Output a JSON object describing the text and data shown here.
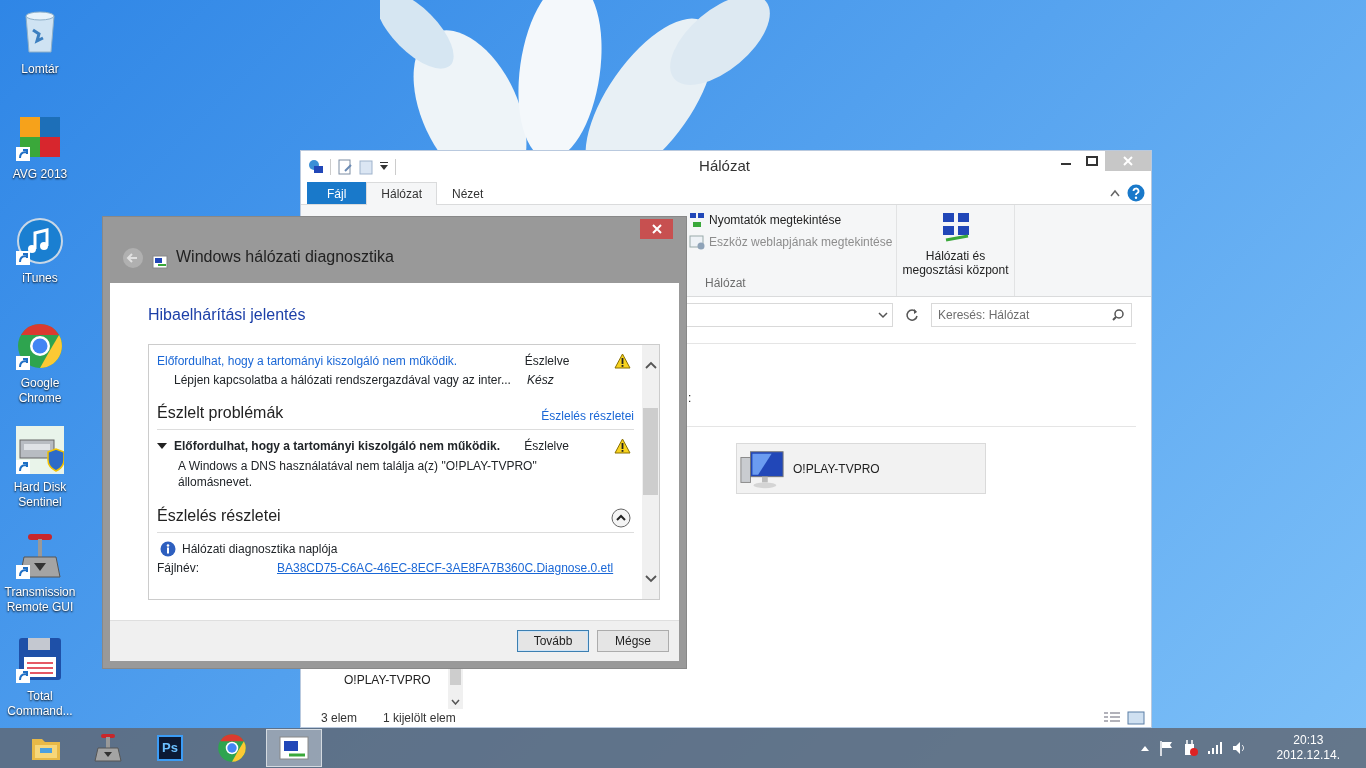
{
  "desktop": {
    "icons": [
      {
        "label": "Lomtár",
        "kind": "bin",
        "shortcut": false
      },
      {
        "label": "AVG 2013",
        "kind": "avg",
        "shortcut": true
      },
      {
        "label": "iTunes",
        "kind": "music",
        "shortcut": true
      },
      {
        "label": "Google Chrome",
        "kind": "chrome",
        "shortcut": true
      },
      {
        "label": "Hard Disk Sentinel",
        "kind": "disk",
        "shortcut": true
      },
      {
        "label": "Transmission Remote GUI",
        "kind": "transmission",
        "shortcut": true
      },
      {
        "label": "Total Command...",
        "kind": "floppy",
        "shortcut": true
      }
    ]
  },
  "explorer": {
    "title": "Hálózat",
    "tabs": [
      {
        "label": "Fájl",
        "kind": "file",
        "selected": false
      },
      {
        "label": "Hálózat",
        "kind": "tab",
        "selected": true
      },
      {
        "label": "Nézet",
        "kind": "tab",
        "selected": false
      }
    ],
    "ribbon": {
      "commands": [
        {
          "label": "Nyomtatók megtekintése",
          "disabled": false
        },
        {
          "label": "Eszköz weblapjának megtekintése",
          "disabled": true
        }
      ],
      "group_label": "Hálózat",
      "big_button": "Hálózati és megosztási központ"
    },
    "search": {
      "placeholder": "Keresés: Hálózat"
    },
    "content_fragment": ":",
    "devices": [
      {
        "name": "O!PLAY-TVPRO",
        "selected": true
      }
    ],
    "nav_items": [
      {
        "label": "O!PLAY-TVPRO"
      }
    ],
    "status_bar": {
      "items": "3 elem",
      "selection": "1 kijelölt elem"
    }
  },
  "dialog": {
    "title": "Windows hálózati diagnosztika",
    "heading": "Hibaelhárítási jelentés",
    "summary": [
      {
        "text": "Előfordulhat, hogy a tartományi kiszolgáló nem működik.",
        "status": "Észlelve",
        "kind": "issue"
      },
      {
        "text": "Lépjen kapcsolatba a hálózati rendszergazdával vagy az inter...",
        "status": "Kész",
        "kind": "step"
      }
    ],
    "problems": {
      "title": "Észlelt problémák",
      "link": "Észlelés részletei",
      "items": [
        {
          "title": "Előfordulhat, hogy a tartományi kiszolgáló nem működik.",
          "status": "Észlelve",
          "expanded": true,
          "description": "A Windows a DNS használatával nem találja a(z) \"O!PLAY-TVPRO\" állomásnevet."
        }
      ]
    },
    "details": {
      "title": "Észlelés részletei",
      "expanded": true,
      "log_title": "Hálózati diagnosztika naplója",
      "file_label": "Fájlnév:",
      "file_link": "BA38CD75-C6AC-46EC-8ECF-3AE8FA7B360C.Diagnose.0.etl"
    },
    "buttons": [
      {
        "label": "Tovább",
        "default": true
      },
      {
        "label": "Mégse",
        "default": false
      }
    ]
  },
  "taskbar": {
    "apps": [
      {
        "kind": "folder",
        "selected": false
      },
      {
        "kind": "transmission",
        "selected": false
      },
      {
        "kind": "photoshop",
        "label": "Ps",
        "selected": false
      },
      {
        "kind": "chrome",
        "selected": false
      },
      {
        "kind": "network",
        "selected": true
      }
    ],
    "time": "20:13",
    "date": "2012.12.14."
  }
}
